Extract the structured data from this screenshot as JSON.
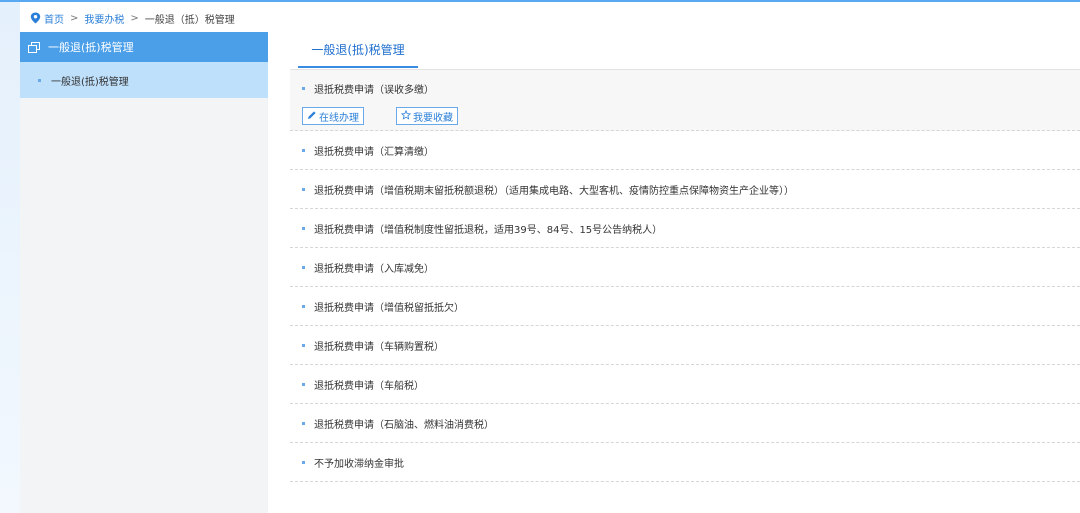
{
  "breadcrumb": {
    "home": "首页",
    "separator": ">",
    "level2": "我要办税",
    "current": "一般退（抵）税管理"
  },
  "sidebar": {
    "header": "一般退(抵)税管理",
    "items": [
      {
        "label": "一般退(抵)税管理"
      }
    ]
  },
  "main": {
    "tab": "一般退(抵)税管理",
    "items": [
      {
        "label": "退抵税费申请（误收多缴）"
      },
      {
        "label": "退抵税费申请（汇算清缴）"
      },
      {
        "label": "退抵税费申请（增值税期末留抵税额退税）（适用集成电路、大型客机、疫情防控重点保障物资生产企业等））"
      },
      {
        "label": "退抵税费申请（增值税制度性留抵退税，适用39号、84号、15号公告纳税人）"
      },
      {
        "label": "退抵税费申请（入库减免）"
      },
      {
        "label": "退抵税费申请（增值税留抵抵欠）"
      },
      {
        "label": "退抵税费申请（车辆购置税）"
      },
      {
        "label": "退抵税费申请（车船税）"
      },
      {
        "label": "退抵税费申请（石脑油、燃料油消费税）"
      },
      {
        "label": "不予加收滞纳金审批"
      }
    ],
    "actions": {
      "online": "在线办理",
      "favorite": "我要收藏"
    }
  },
  "colors": {
    "accent": "#4b9fe8",
    "link": "#2b7fd8",
    "sidebar_active": "#bfe0fb"
  },
  "icons": {
    "breadcrumb": "location-pin-icon",
    "sidebar_header": "window-icon",
    "online": "pencil-icon",
    "favorite": "star-icon"
  }
}
